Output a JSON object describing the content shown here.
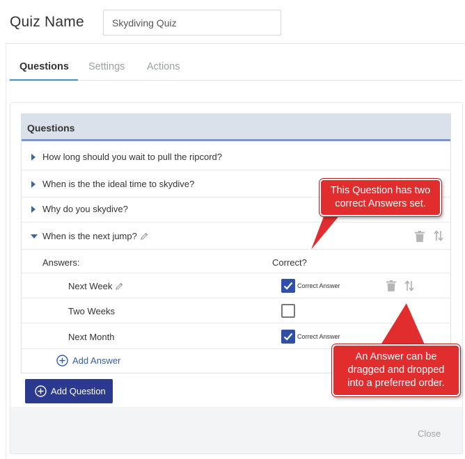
{
  "quiz": {
    "name_label": "Quiz Name",
    "name_value": "Skydiving Quiz"
  },
  "tabs": [
    {
      "label": "Questions",
      "active": true
    },
    {
      "label": "Settings",
      "active": false
    },
    {
      "label": "Actions",
      "active": false
    }
  ],
  "questions_panel": {
    "title": "Questions",
    "questions": [
      {
        "text": "How long should you wait to pull the ripcord?",
        "expanded": false
      },
      {
        "text": "When is the the ideal time to skydive?",
        "expanded": false
      },
      {
        "text": "Why do you skydive?",
        "expanded": false
      },
      {
        "text": "When is the next jump?",
        "expanded": true
      }
    ],
    "answers_header": "Answers:",
    "correct_header": "Correct?",
    "answers": [
      {
        "text": "Next Week",
        "correct": true,
        "correct_label": "Correct Answer"
      },
      {
        "text": "Two Weeks",
        "correct": false,
        "correct_label": ""
      },
      {
        "text": "Next Month",
        "correct": true,
        "correct_label": "Correct Answer"
      }
    ],
    "add_answer_label": "Add Answer"
  },
  "buttons": {
    "add_question": "Add Question",
    "close": "Close"
  },
  "callouts": {
    "question": [
      "This Question has two",
      "correct Answers set."
    ],
    "answer": [
      "An Answer can be",
      "dragged and dropped",
      "into a preferred order."
    ]
  },
  "colors": {
    "accent_tab": "#3b8fd6",
    "header_bg": "#dbe1ea",
    "header_rule": "#7b95c9",
    "primary_button": "#2b3a8f",
    "checkbox_on": "#2f4fa8",
    "callout": "#e22d2f",
    "link": "#2f5ea8"
  }
}
